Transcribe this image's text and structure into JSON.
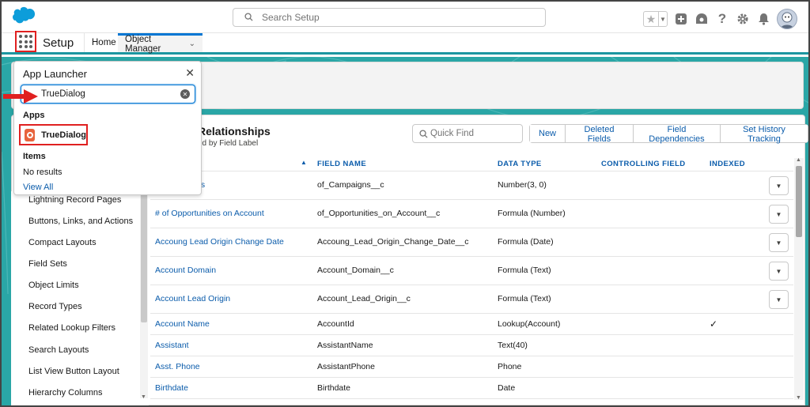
{
  "header": {
    "search_placeholder": "Search Setup",
    "icons": [
      "salesforce-logo",
      "favorites-star-icon",
      "chevron-down-icon",
      "add-icon",
      "trailhead-icon",
      "help-icon",
      "settings-gear-icon",
      "notifications-bell-icon",
      "avatar"
    ]
  },
  "context_bar": {
    "app_name": "Setup",
    "tabs": [
      {
        "label": "Home"
      },
      {
        "label": "Object Manager"
      }
    ]
  },
  "app_launcher": {
    "title": "App Launcher",
    "search_value": "TrueDialog",
    "apps_heading": "Apps",
    "app_result": "TrueDialog",
    "items_heading": "Items",
    "items_result": "No results",
    "view_all": "View All"
  },
  "left_nav": {
    "items": [
      "Lightning Record Pages",
      "Buttons, Links, and Actions",
      "Compact Layouts",
      "Field Sets",
      "Object Limits",
      "Record Types",
      "Related Lookup Filters",
      "Search Layouts",
      "List View Button Layout",
      "Hierarchy Columns"
    ]
  },
  "section": {
    "title": "Relationships",
    "subtitle": "ed by Field Label",
    "quick_find_placeholder": "Quick Find",
    "buttons": [
      "New",
      "Deleted Fields",
      "Field Dependencies",
      "Set History Tracking"
    ]
  },
  "table": {
    "columns": [
      "FIELD NAME",
      "DATA TYPE",
      "CONTROLLING FIELD",
      "INDEXED"
    ],
    "rows": [
      {
        "label": "ns",
        "field_name": "of_Campaigns__c",
        "data_type": "Number(3, 0)",
        "indexed": "",
        "has_menu": true
      },
      {
        "label": "# of Opportunities on Account",
        "field_name": "of_Opportunities_on_Account__c",
        "data_type": "Formula (Number)",
        "indexed": "",
        "has_menu": true
      },
      {
        "label": "Accoung Lead Origin Change Date",
        "field_name": "Accoung_Lead_Origin_Change_Date__c",
        "data_type": "Formula (Date)",
        "indexed": "",
        "has_menu": true
      },
      {
        "label": "Account Domain",
        "field_name": "Account_Domain__c",
        "data_type": "Formula (Text)",
        "indexed": "",
        "has_menu": true
      },
      {
        "label": "Account Lead Origin",
        "field_name": "Account_Lead_Origin__c",
        "data_type": "Formula (Text)",
        "indexed": "",
        "has_menu": true
      },
      {
        "label": "Account Name",
        "field_name": "AccountId",
        "data_type": "Lookup(Account)",
        "indexed": "✓",
        "has_menu": false
      },
      {
        "label": "Assistant",
        "field_name": "AssistantName",
        "data_type": "Text(40)",
        "indexed": "",
        "has_menu": false
      },
      {
        "label": "Asst. Phone",
        "field_name": "AssistantPhone",
        "data_type": "Phone",
        "indexed": "",
        "has_menu": false
      },
      {
        "label": "Birthdate",
        "field_name": "Birthdate",
        "data_type": "Date",
        "indexed": "",
        "has_menu": false
      }
    ]
  },
  "colors": {
    "brand_blue": "#0176d3",
    "link_blue": "#0b5cab",
    "teal_background": "#2aa6a6",
    "highlight_red": "#e02020"
  }
}
